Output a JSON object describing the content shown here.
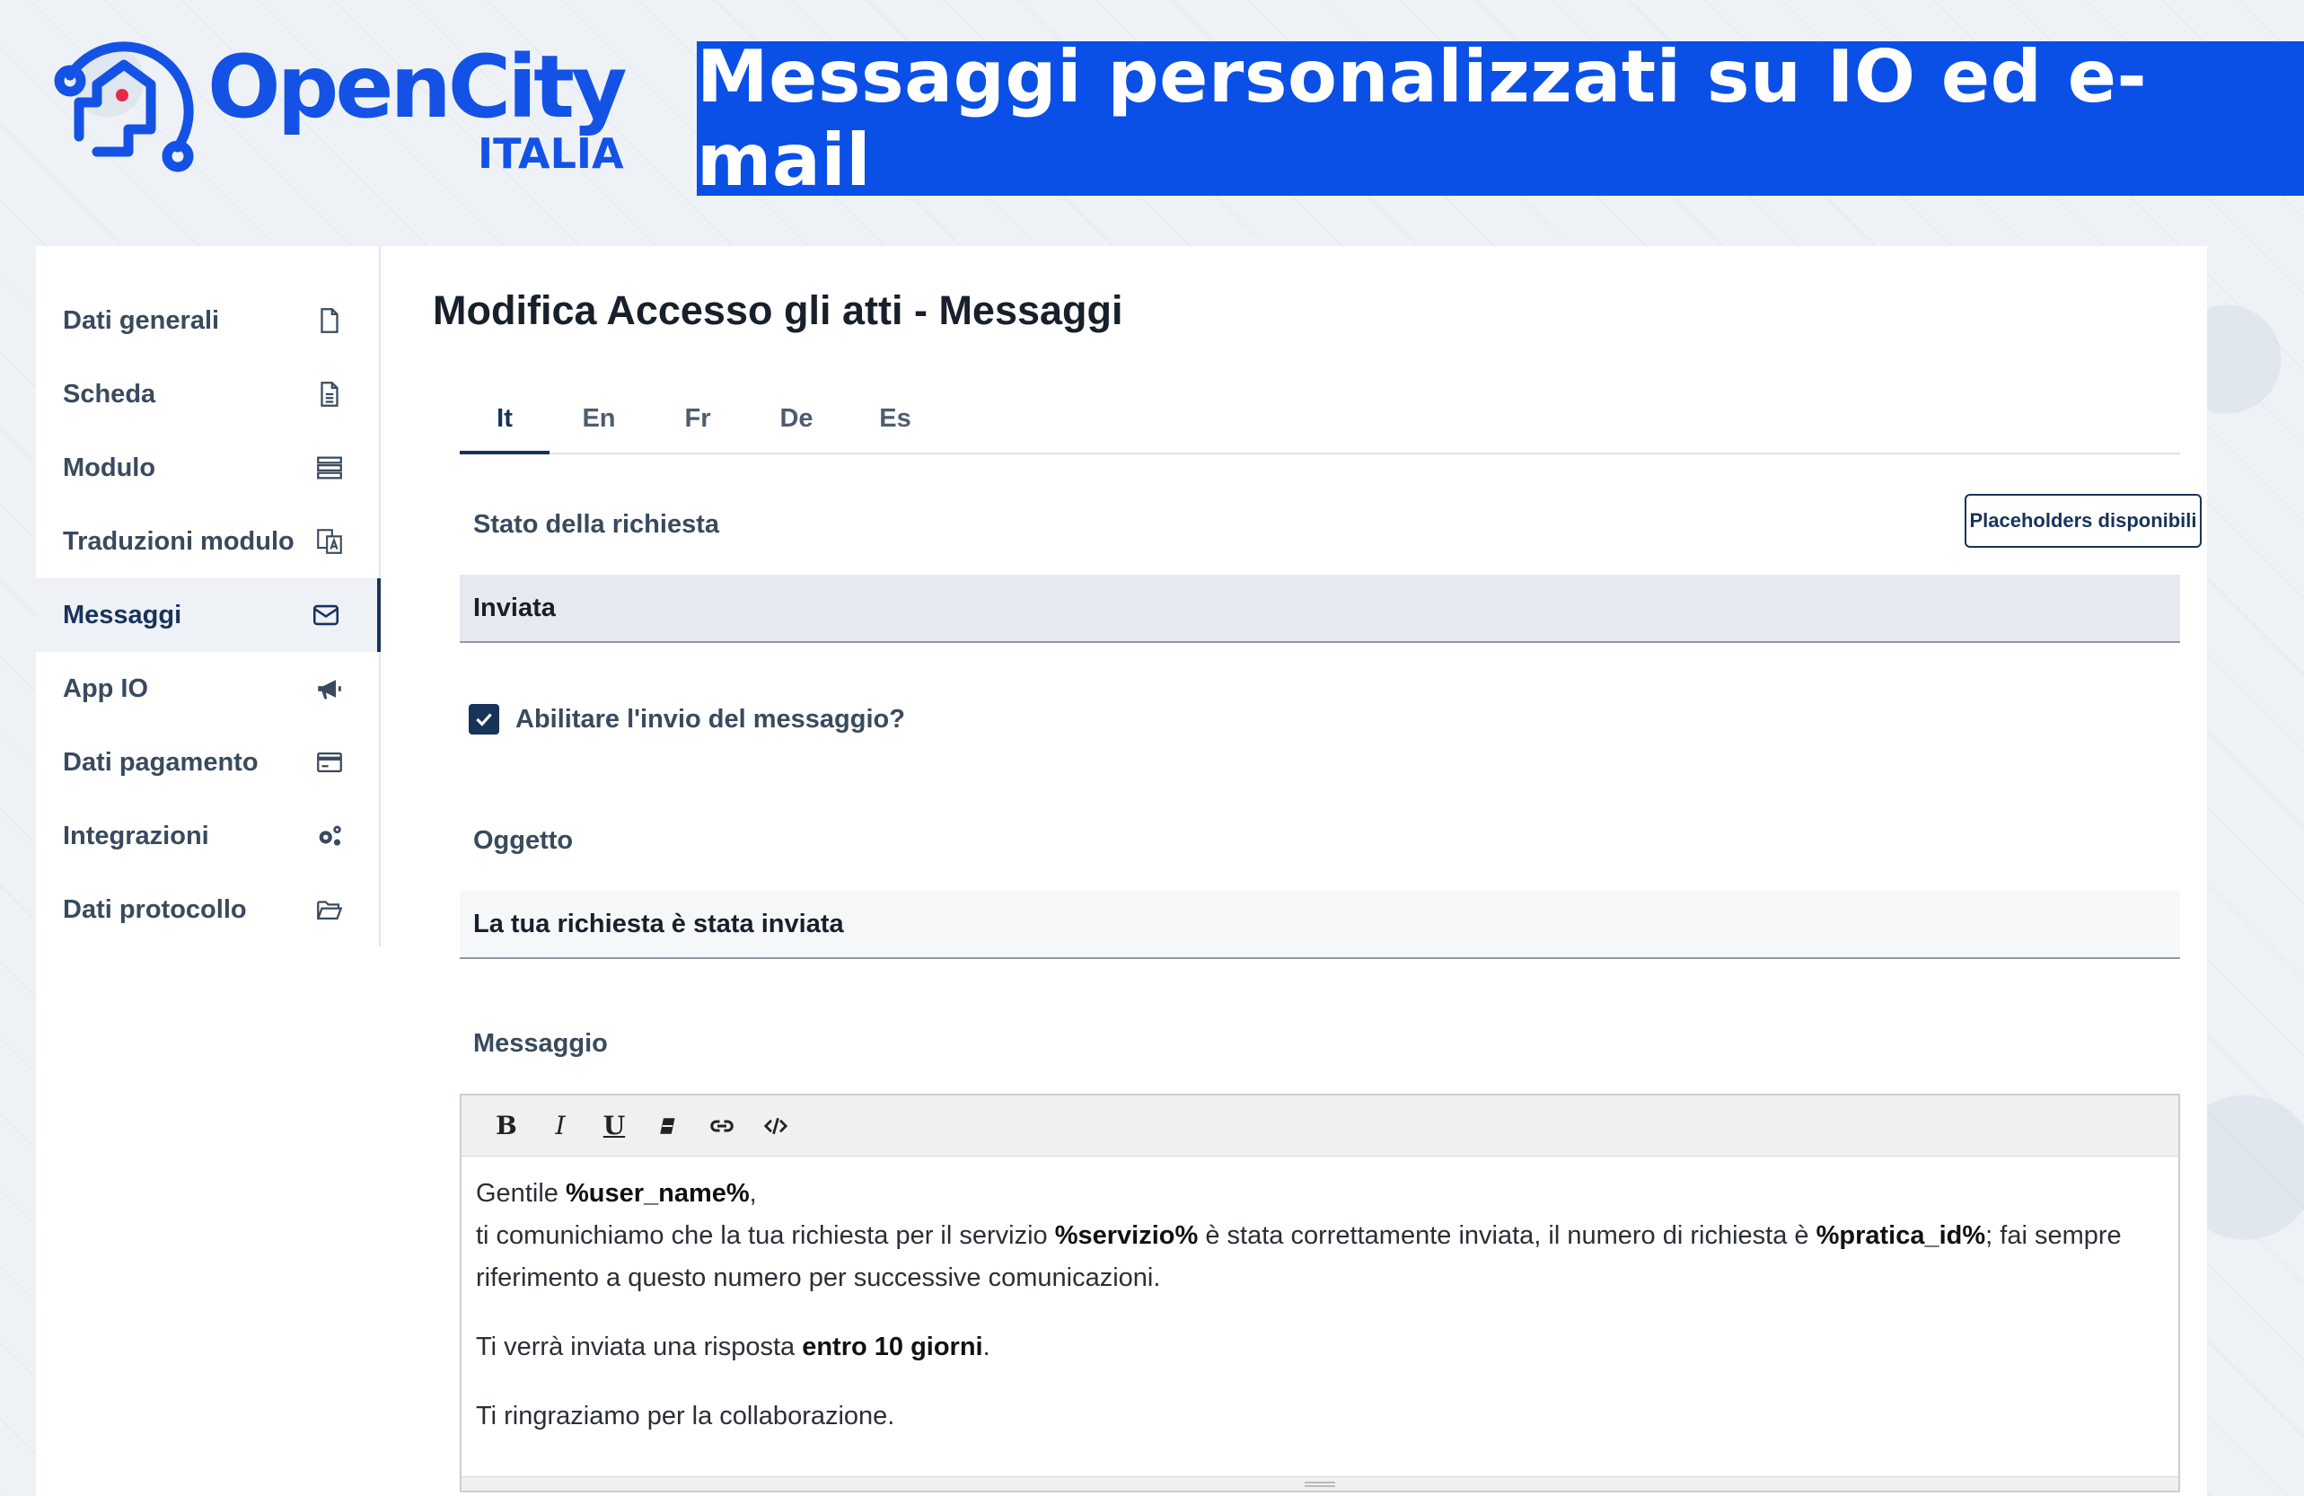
{
  "header": {
    "logo_name": "OpenCity",
    "logo_sub": "ITALIA",
    "banner_title": "Messaggi personalizzati su IO ed e-mail"
  },
  "sidebar": {
    "items": [
      {
        "label": "Dati generali",
        "icon": "file-icon"
      },
      {
        "label": "Scheda",
        "icon": "document-lines-icon"
      },
      {
        "label": "Modulo",
        "icon": "server-icon"
      },
      {
        "label": "Traduzioni modulo",
        "icon": "translate-icon"
      },
      {
        "label": "Messaggi",
        "icon": "envelope-icon",
        "active": true
      },
      {
        "label": "App IO",
        "icon": "megaphone-icon"
      },
      {
        "label": "Dati pagamento",
        "icon": "credit-card-icon"
      },
      {
        "label": "Integrazioni",
        "icon": "gears-icon"
      },
      {
        "label": "Dati protocollo",
        "icon": "folder-open-icon"
      }
    ]
  },
  "main": {
    "title": "Modifica Accesso gli atti - Messaggi",
    "tabs": [
      "It",
      "En",
      "Fr",
      "De",
      "Es"
    ],
    "active_tab": "It",
    "status_label": "Stato della richiesta",
    "placeholders_button": "Placeholders disponibili",
    "status_value": "Inviata",
    "enable_label": "Abilitare l'invio del messaggio?",
    "enable_checked": true,
    "subject_label": "Oggetto",
    "subject_value": "La tua richiesta è stata inviata",
    "message_label": "Messaggio",
    "toolbar": [
      "B",
      "I",
      "U",
      "eraser-icon",
      "link-icon",
      "code-icon"
    ],
    "message": {
      "greeting_prefix": "Gentile ",
      "user_placeholder": "%user_name%",
      "greeting_suffix": ",",
      "line1_a": "ti comunichiamo che la tua richiesta per il servizio ",
      "servizio_placeholder": "%servizio%",
      "line1_b": " è stata correttamente inviata, il numero di richiesta è ",
      "pratica_placeholder": "%pratica_id%",
      "line1_c": "; fai sempre riferimento a questo numero per successive comunicazioni.",
      "p2_a": "Ti verrà inviata una risposta ",
      "p2_bold": "entro 10 giorni",
      "p2_b": ".",
      "p3": "Ti ringraziamo per la collaborazione."
    }
  },
  "colors": {
    "brand_blue": "#0a50e6",
    "nav_dark": "#17335a"
  }
}
